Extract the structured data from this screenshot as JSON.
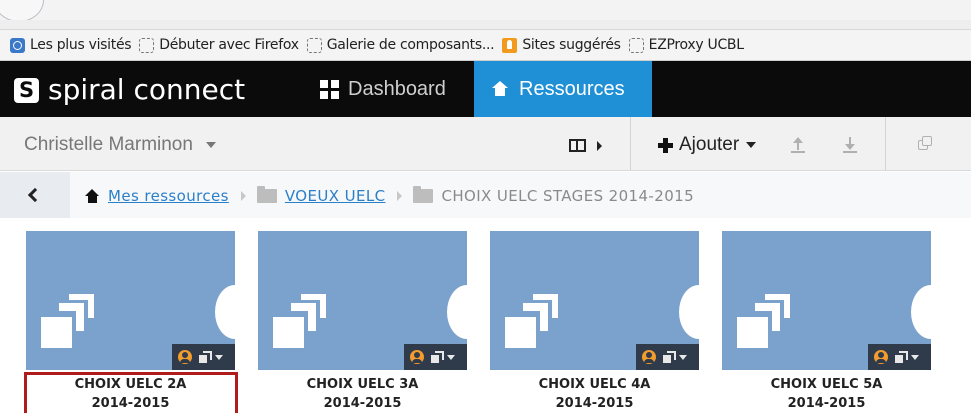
{
  "bookmarks": [
    {
      "label": "Les plus visités",
      "icon": "globe-icon"
    },
    {
      "label": "Débuter avec Firefox",
      "icon": "bookmark-icon"
    },
    {
      "label": "Galerie de composants...",
      "icon": "bookmark-icon"
    },
    {
      "label": "Sites suggérés",
      "icon": "lightbulb-icon"
    },
    {
      "label": "EZProxy UCBL",
      "icon": "bookmark-icon"
    }
  ],
  "app": {
    "logo_text": "spiral connect",
    "nav": {
      "dashboard_label": "Dashboard",
      "ressources_label": "Ressources"
    },
    "accent_color": "#1f8fd6"
  },
  "toolbar": {
    "user_name": "Christelle Marminon",
    "add_label": "Ajouter"
  },
  "breadcrumb": {
    "items": [
      "Mes ressources",
      "VOEUX UELC",
      "CHOIX UELC STAGES 2014-2015"
    ]
  },
  "tiles": [
    {
      "line1": "CHOIX UELC 2A",
      "line2": "2014-2015"
    },
    {
      "line1": "CHOIX UELC 3A",
      "line2": "2014-2015"
    },
    {
      "line1": "CHOIX UELC 4A",
      "line2": "2014-2015"
    },
    {
      "line1": "CHOIX UELC 5A",
      "line2": "2014-2015"
    }
  ]
}
